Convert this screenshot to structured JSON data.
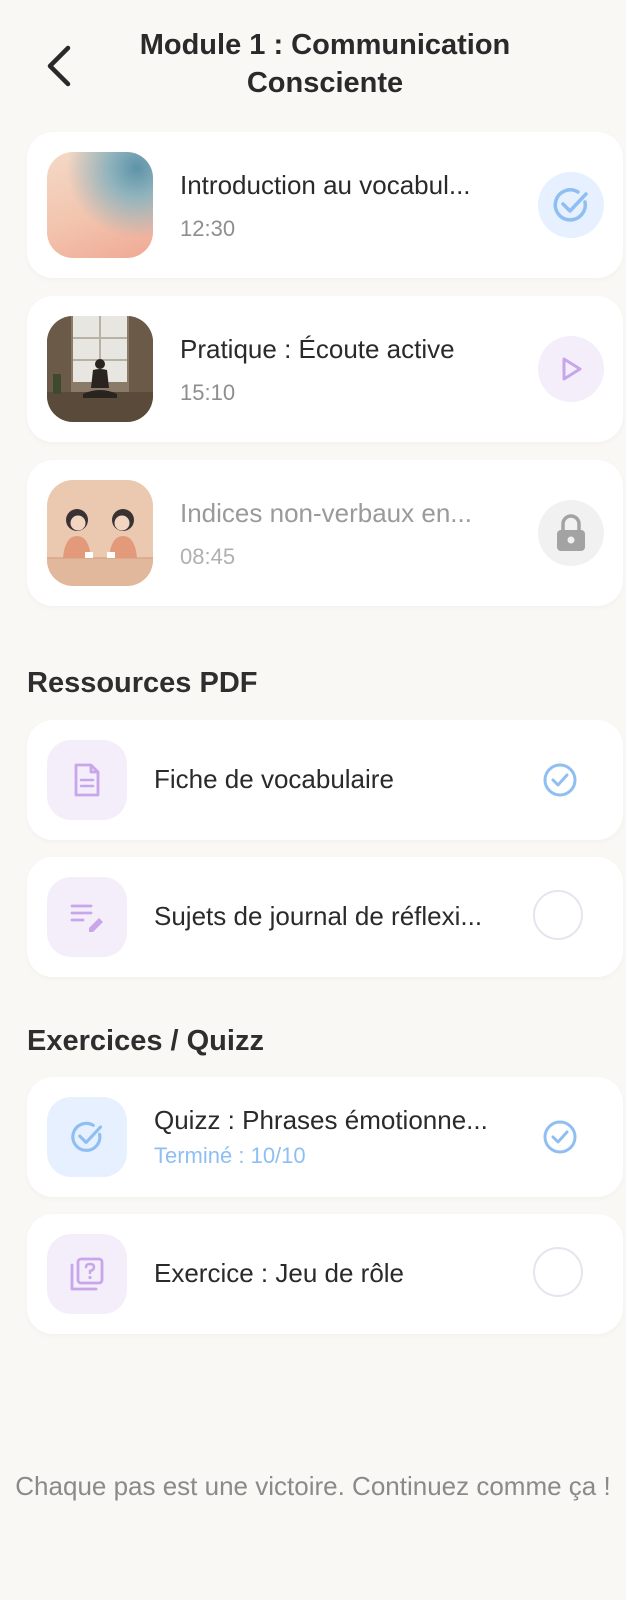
{
  "header": {
    "title": "Module 1 : Communication Consciente",
    "back_icon": "chevron-left-icon"
  },
  "lessons": [
    {
      "title": "Introduction au vocabul...",
      "duration": "12:30",
      "status": "completed",
      "status_icon": "check-circle-icon",
      "thumbnail": "gradient-abstract-image"
    },
    {
      "title": "Pratique : Écoute active",
      "duration": "15:10",
      "status": "available",
      "status_icon": "play-icon",
      "thumbnail": "meditation-photo"
    },
    {
      "title": "Indices non-verbaux en...",
      "duration": "08:45",
      "status": "locked",
      "status_icon": "lock-icon",
      "thumbnail": "two-women-illustration"
    }
  ],
  "resources": {
    "heading": "Ressources PDF",
    "items": [
      {
        "label": "Fiche de vocabulaire",
        "icon": "document-icon",
        "done": true
      },
      {
        "label": "Sujets de journal de réflexi...",
        "icon": "note-edit-icon",
        "done": false
      }
    ]
  },
  "exercises": {
    "heading": "Exercices / Quizz",
    "items": [
      {
        "label": "Quizz : Phrases émotionne...",
        "sub": "Terminé : 10/10",
        "icon": "check-circle-icon",
        "done": true
      },
      {
        "label": "Exercice : Jeu de rôle",
        "icon": "question-stack-icon",
        "done": false
      }
    ]
  },
  "footer": {
    "message": "Chaque pas est une victoire. Continuez comme ça !"
  },
  "colors": {
    "background": "#faf8f5",
    "accent_blue": "#8fbff2",
    "accent_purple": "#c7a6ea",
    "check_bg": "#e6f0ff",
    "purple_bg": "#f4eefb"
  }
}
